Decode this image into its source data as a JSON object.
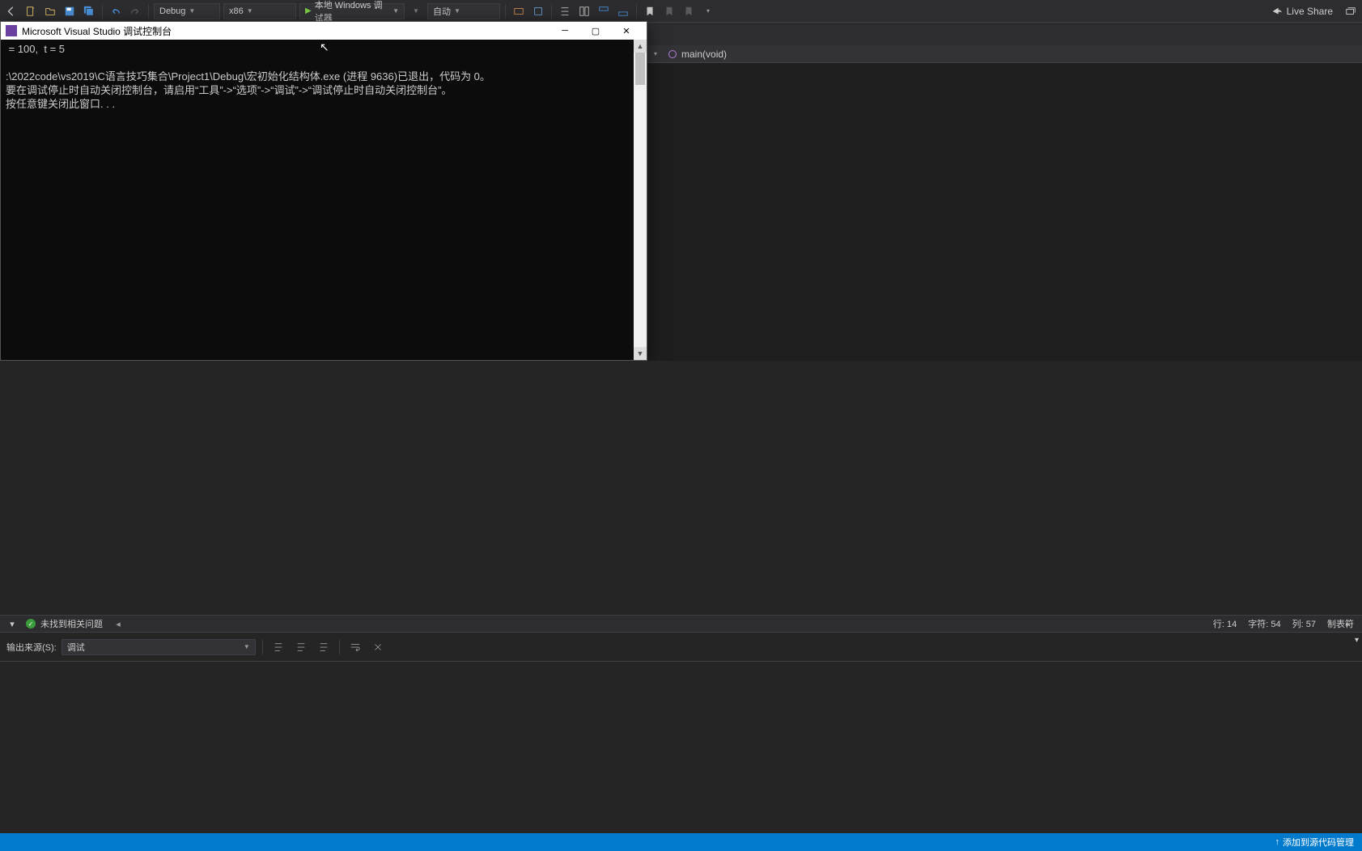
{
  "toolbar": {
    "config": "Debug",
    "platform": "x86",
    "debugger": "本地 Windows 调试器",
    "mode": "自动",
    "liveshare": "Live Share"
  },
  "nav": {
    "scope": "main(void)"
  },
  "console": {
    "title": "Microsoft Visual Studio 调试控制台",
    "line1": " = 100,  t = 5",
    "line2": "",
    "line3": ":\\2022code\\vs2019\\C语言技巧集合\\Project1\\Debug\\宏初始化结构体.exe (进程 9636)已退出，代码为 0。",
    "line4": "要在调试停止时自动关闭控制台，请启用“工具”->“选项”->“调试”->“调试停止时自动关闭控制台”。",
    "line5": "按任意键关闭此窗口. . ."
  },
  "errbar": {
    "message": "未找到相关问题"
  },
  "output": {
    "source_label": "输出来源(S):",
    "source_value": "调试"
  },
  "pos": {
    "line_label": "行:",
    "line_value": "14",
    "char_label": "字符:",
    "char_value": "54",
    "col_label": "列:",
    "col_value": "57",
    "tab": "制表符"
  },
  "status": {
    "source_control": "添加到源代码管理"
  }
}
